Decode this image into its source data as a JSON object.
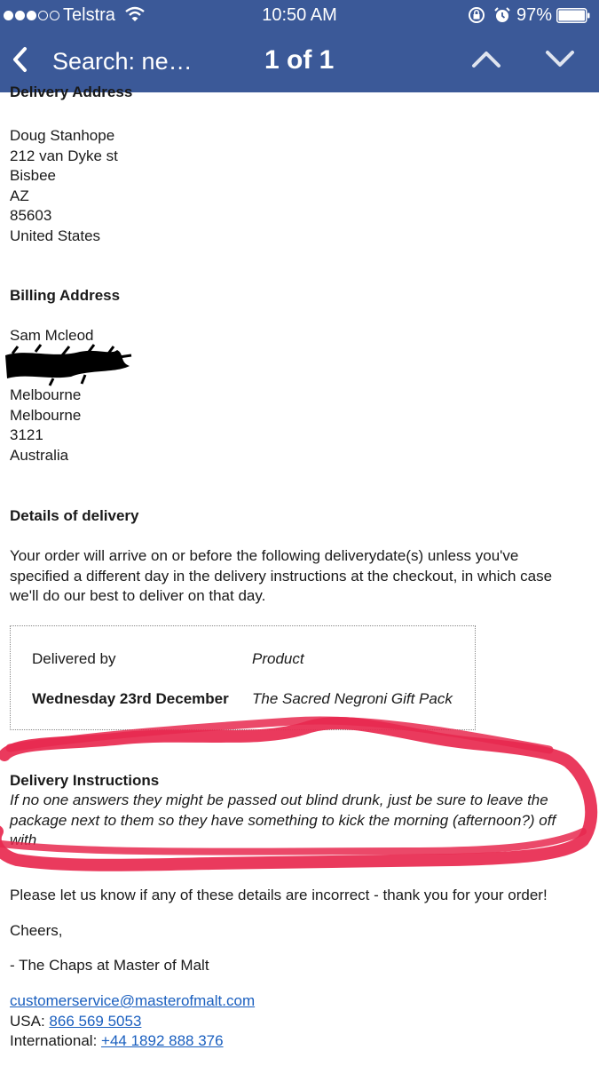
{
  "status_bar": {
    "carrier": "Telstra",
    "time": "10:50 AM",
    "battery": "97%"
  },
  "nav": {
    "search_label": "Search: ne…",
    "count": "1 of 1"
  },
  "email": {
    "cut_heading": "Delivery Address",
    "delivery_address": [
      "Doug Stanhope",
      "212 van Dyke st",
      "Bisbee",
      "AZ",
      "85603",
      "United States"
    ],
    "billing_heading": "Billing Address",
    "billing_name": "Sam Mcleod",
    "billing_address": [
      "Melbourne",
      "Melbourne",
      "3121",
      "Australia"
    ],
    "details_heading": "Details of delivery",
    "details_text": "Your order will arrive on or before the following deliverydate(s) unless you've specified a different day in the delivery instructions at the checkout, in which case we'll do our best to deliver on that day.",
    "table": {
      "col1_header": "Delivered by",
      "col2_header": "Product",
      "col1_value": "Wednesday 23rd December",
      "col2_value": "The Sacred Negroni Gift Pack"
    },
    "instructions_heading": "Delivery Instructions",
    "instructions_text": "If no one answers they might be passed out blind drunk, just be sure to leave the package next to them so they have something to kick the morning (afternoon?) off with",
    "closing": "Please let us know if any of these details are incorrect - thank you for your order!",
    "cheers": "Cheers,",
    "signature": "- The Chaps at Master of Malt",
    "email_link": "customerservice@masterofmalt.com",
    "usa_label": "USA: ",
    "usa_phone": "866 569 5053",
    "intl_label": "International: ",
    "intl_phone": "+44 1892 888 376"
  },
  "colors": {
    "nav_bar": "#3b5998",
    "link": "#1a5fbf",
    "annotation": "#e8294f"
  }
}
